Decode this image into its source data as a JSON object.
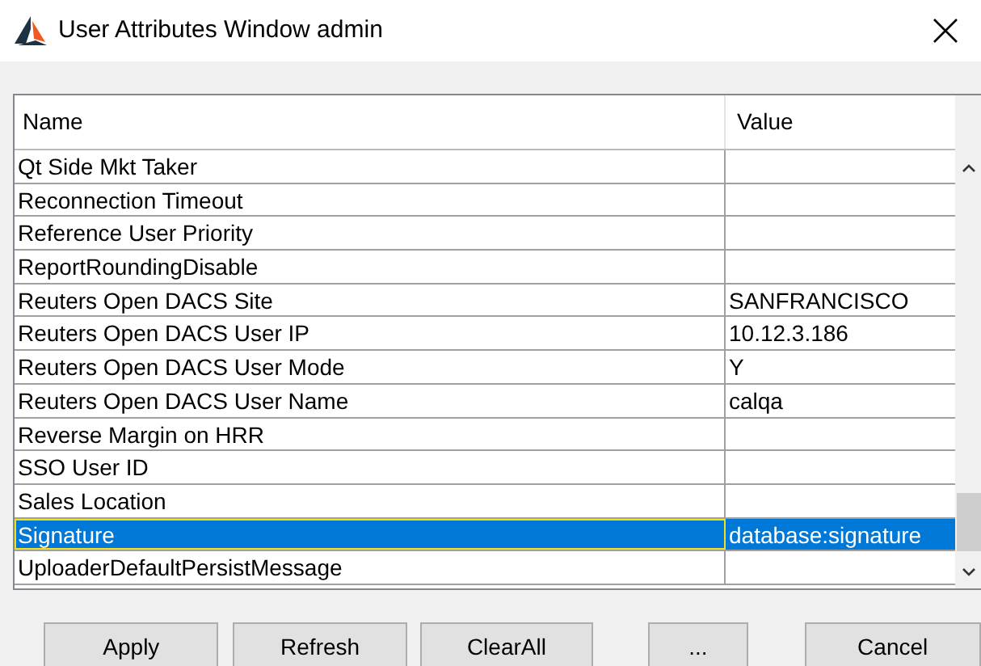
{
  "window": {
    "title": "User Attributes Window admin"
  },
  "table": {
    "columns": [
      "Name",
      "Value"
    ],
    "rows": [
      {
        "name": "Qt Side Mkt Taker",
        "value": "",
        "selected": false
      },
      {
        "name": "Reconnection Timeout",
        "value": "",
        "selected": false
      },
      {
        "name": "Reference User Priority",
        "value": "",
        "selected": false
      },
      {
        "name": "ReportRoundingDisable",
        "value": "",
        "selected": false
      },
      {
        "name": "Reuters Open DACS Site",
        "value": "SANFRANCISCO",
        "selected": false
      },
      {
        "name": "Reuters Open DACS User IP",
        "value": "10.12.3.186",
        "selected": false
      },
      {
        "name": "Reuters Open DACS User Mode",
        "value": "Y",
        "selected": false
      },
      {
        "name": "Reuters Open DACS User Name",
        "value": "calqa",
        "selected": false
      },
      {
        "name": "Reverse Margin on HRR",
        "value": "",
        "selected": false
      },
      {
        "name": "SSO User ID",
        "value": "",
        "selected": false
      },
      {
        "name": "Sales Location",
        "value": "",
        "selected": false
      },
      {
        "name": "Signature",
        "value": "database:signature",
        "selected": true
      },
      {
        "name": "UploaderDefaultPersistMessage",
        "value": "",
        "selected": false
      }
    ]
  },
  "buttons": [
    "Apply",
    "Refresh",
    "ClearAll",
    "...",
    "Cancel"
  ]
}
